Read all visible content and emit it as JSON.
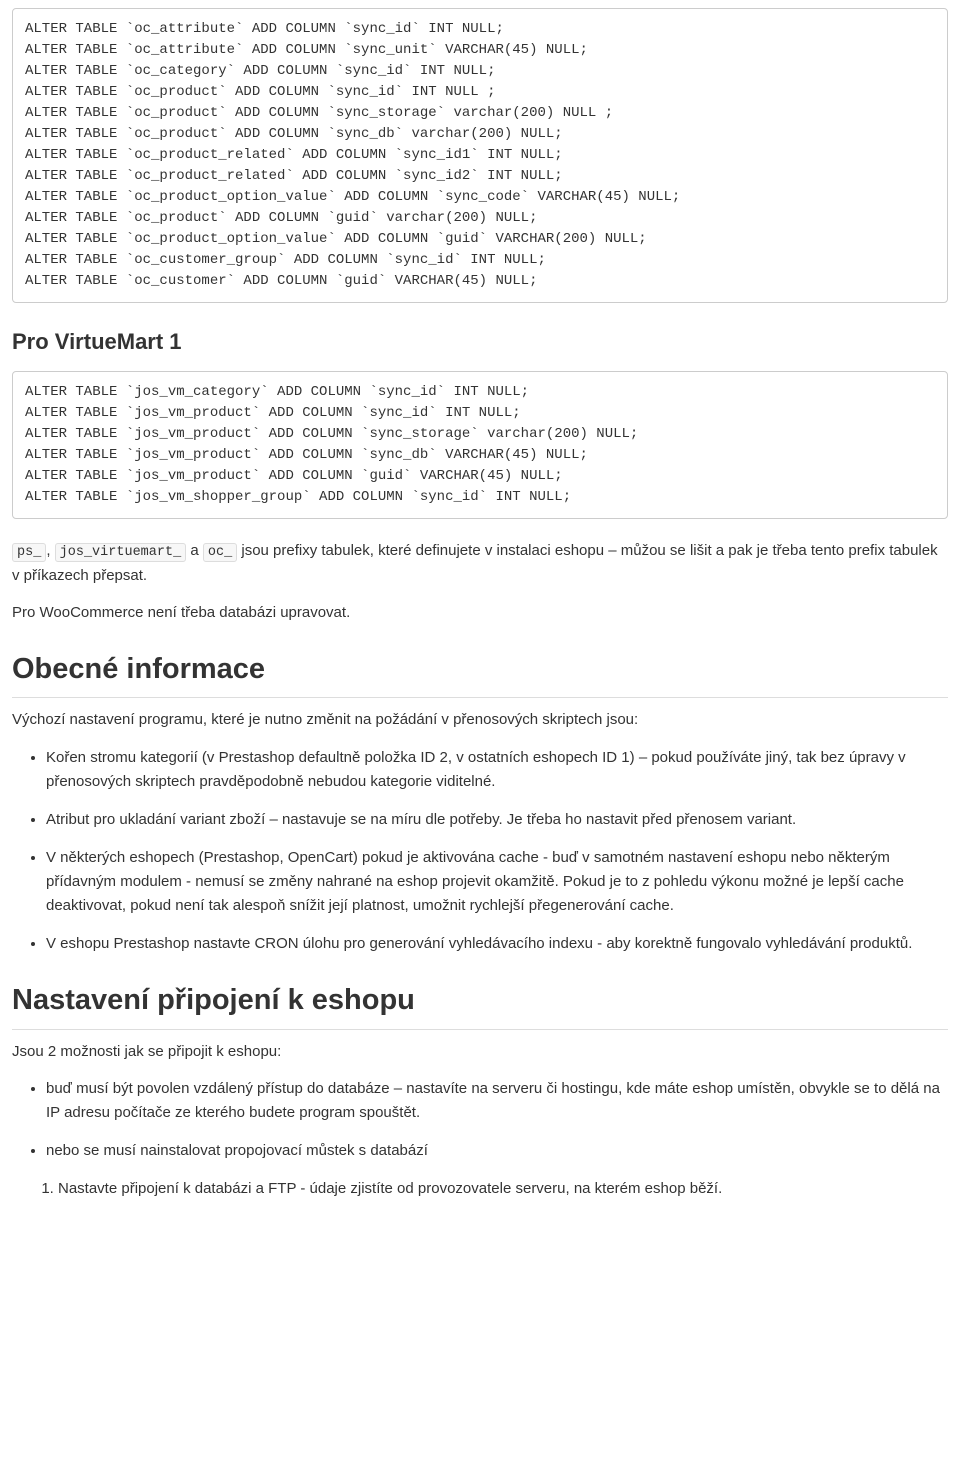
{
  "code1": "ALTER TABLE `oc_attribute` ADD COLUMN `sync_id` INT NULL;\nALTER TABLE `oc_attribute` ADD COLUMN `sync_unit` VARCHAR(45) NULL;\nALTER TABLE `oc_category` ADD COLUMN `sync_id` INT NULL;\nALTER TABLE `oc_product` ADD COLUMN `sync_id` INT NULL ;\nALTER TABLE `oc_product` ADD COLUMN `sync_storage` varchar(200) NULL ;\nALTER TABLE `oc_product` ADD COLUMN `sync_db` varchar(200) NULL;\nALTER TABLE `oc_product_related` ADD COLUMN `sync_id1` INT NULL;\nALTER TABLE `oc_product_related` ADD COLUMN `sync_id2` INT NULL;\nALTER TABLE `oc_product_option_value` ADD COLUMN `sync_code` VARCHAR(45) NULL;\nALTER TABLE `oc_product` ADD COLUMN `guid` varchar(200) NULL;\nALTER TABLE `oc_product_option_value` ADD COLUMN `guid` VARCHAR(200) NULL;\nALTER TABLE `oc_customer_group` ADD COLUMN `sync_id` INT NULL;\nALTER TABLE `oc_customer` ADD COLUMN `guid` VARCHAR(45) NULL;",
  "heading1": "Pro VirtueMart 1",
  "code2": "ALTER TABLE `jos_vm_category` ADD COLUMN `sync_id` INT NULL;\nALTER TABLE `jos_vm_product` ADD COLUMN `sync_id` INT NULL;\nALTER TABLE `jos_vm_product` ADD COLUMN `sync_storage` varchar(200) NULL;\nALTER TABLE `jos_vm_product` ADD COLUMN `sync_db` VARCHAR(45) NULL;\nALTER TABLE `jos_vm_product` ADD COLUMN `guid` VARCHAR(45) NULL;\nALTER TABLE `jos_vm_shopper_group` ADD COLUMN `sync_id` INT NULL;",
  "prefixes": {
    "p1": "ps_",
    "p2": "jos_virtuemart_",
    "p3": "oc_",
    "sep_a": ", ",
    "sep_b": " a ",
    "rest": " jsou prefixy tabulek, které definujete v instalaci eshopu – můžou se lišit a pak je třeba tento prefix tabulek v příkazech přepsat."
  },
  "woo_note": "Pro WooCommerce není třeba databázi upravovat.",
  "heading2": "Obecné informace",
  "intro2": "Výchozí nastavení programu, které je nutno změnit na požádání v přenosových skriptech jsou:",
  "bullets2": {
    "b1": "Kořen stromu kategorií (v Prestashop defaultně položka ID 2, v ostatních eshopech ID 1) – pokud používáte jiný, tak bez úpravy v přenosových skriptech pravděpodobně nebudou kategorie viditelné.",
    "b2": "Atribut pro ukladání variant zboží – nastavuje se na míru dle potřeby. Je třeba ho nastavit před přenosem variant.",
    "b3": "V některých eshopech (Prestashop, OpenCart) pokud je aktivována cache - buď v samotném nastavení eshopu nebo některým přídavným modulem - nemusí se změny nahrané na eshop projevit okamžitě. Pokud je to z pohledu výkonu možné je lepší cache deaktivovat, pokud není tak alespoň snížit její platnost, umožnit rychlejší přegenerování cache.",
    "b4": "V eshopu Prestashop nastavte CRON úlohu pro generování vyhledávacího indexu - aby korektně fungovalo vyhledávání produktů."
  },
  "heading3": "Nastavení připojení k eshopu",
  "intro3": "Jsou 2 možnosti jak se připojit k eshopu:",
  "bullets3": {
    "b1": "buď musí být povolen vzdálený přístup do databáze – nastavíte na serveru či hostingu, kde máte eshop umístěn, obvykle se to dělá na IP adresu počítače ze kterého budete program spouštět.",
    "b2": "nebo se musí nainstalovat propojovací můstek s databází"
  },
  "ol3": {
    "o1": "Nastavte připojení k databázi a FTP - údaje zjistíte od provozovatele serveru, na kterém eshop běží."
  }
}
